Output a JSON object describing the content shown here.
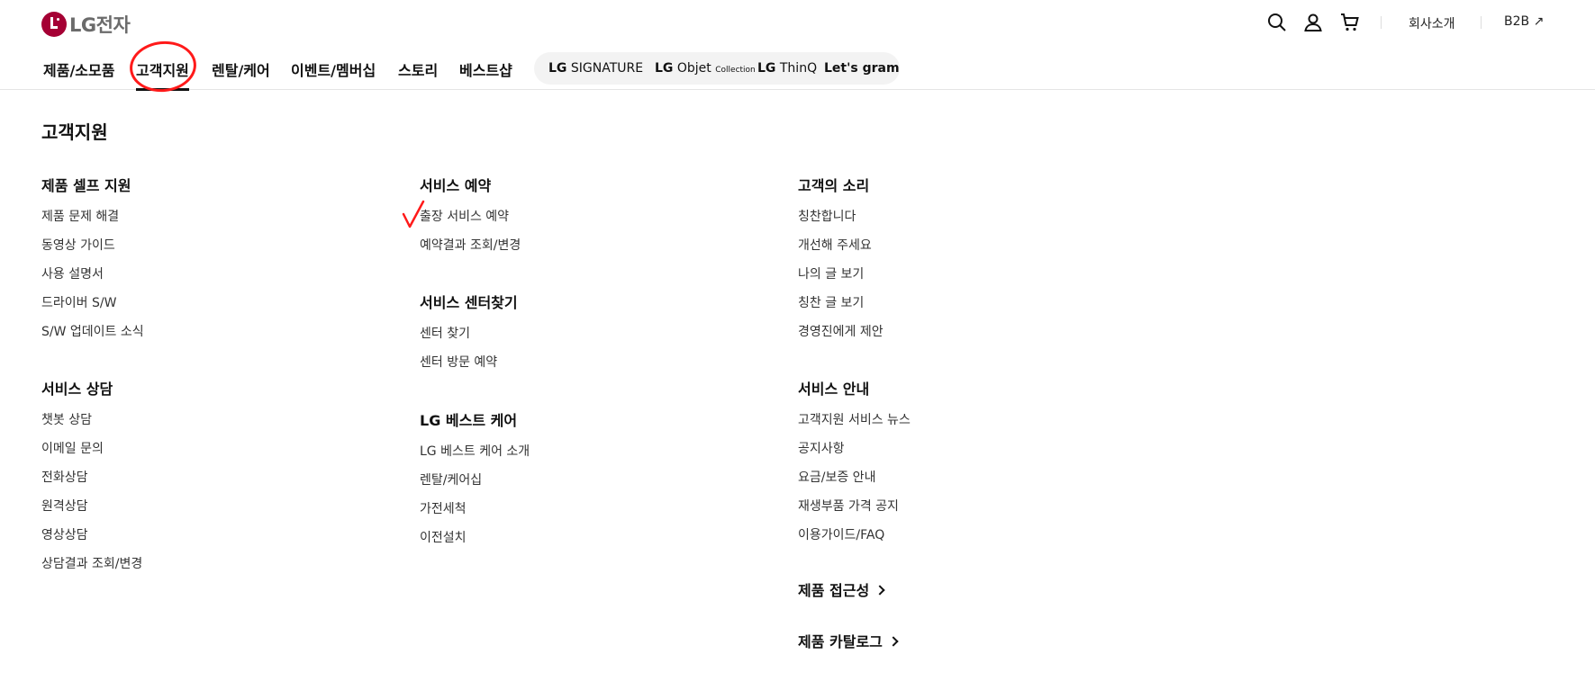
{
  "logo": {
    "text": "LG전자"
  },
  "util": {
    "icons": [
      "search-icon",
      "user-icon",
      "cart-icon"
    ],
    "company": "회사소개",
    "b2b": "B2B ↗"
  },
  "gnb": {
    "items": [
      "제품/소모품",
      "고객지원",
      "렌탈/케어",
      "이벤트/멤버십",
      "스토리",
      "베스트샵"
    ],
    "active_index": 1,
    "brands": {
      "signature_lg": "LG",
      "signature_name": "SIGNATURE",
      "objet_lg": "LG",
      "objet_name": "Objet",
      "objet_sub": "Collection",
      "thinq_lg": "LG",
      "thinq_name": "ThinQ",
      "gram": "Let's gram"
    }
  },
  "menu": {
    "title": "고객지원",
    "col1": [
      {
        "title": "제품 셀프 지원",
        "items": [
          "제품 문제 해결",
          "동영상 가이드",
          "사용 설명서",
          "드라이버 S/W",
          "S/W 업데이트 소식"
        ]
      },
      {
        "title": "서비스 상담",
        "items": [
          "챗봇 상담",
          "이메일 문의",
          "전화상담",
          "원격상담",
          "영상상담",
          "상담결과 조회/변경"
        ]
      }
    ],
    "col2": [
      {
        "title": "서비스 예약",
        "items": [
          "출장 서비스 예약",
          "예약결과 조회/변경"
        ]
      },
      {
        "title": "서비스 센터찾기",
        "items": [
          "센터 찾기",
          "센터 방문 예약"
        ]
      },
      {
        "title": "LG 베스트 케어",
        "items": [
          "LG 베스트 케어 소개",
          "렌탈/케어십",
          "가전세척",
          "이전설치"
        ]
      }
    ],
    "col3": [
      {
        "title": "고객의 소리",
        "items": [
          "칭찬합니다",
          "개선해 주세요",
          "나의 글 보기",
          "칭찬 글 보기",
          "경영진에게 제안"
        ]
      },
      {
        "title": "서비스 안내",
        "items": [
          "고객지원 서비스 뉴스",
          "공지사항",
          "요금/보증 안내",
          "재생부품 가격 공지",
          "이용가이드/FAQ"
        ]
      },
      {
        "title": "제품 접근성",
        "items": []
      },
      {
        "title": "제품 카탈로그",
        "items": []
      }
    ]
  },
  "colors": {
    "brand": "#a50034",
    "annotation": "#ff1a1a"
  }
}
